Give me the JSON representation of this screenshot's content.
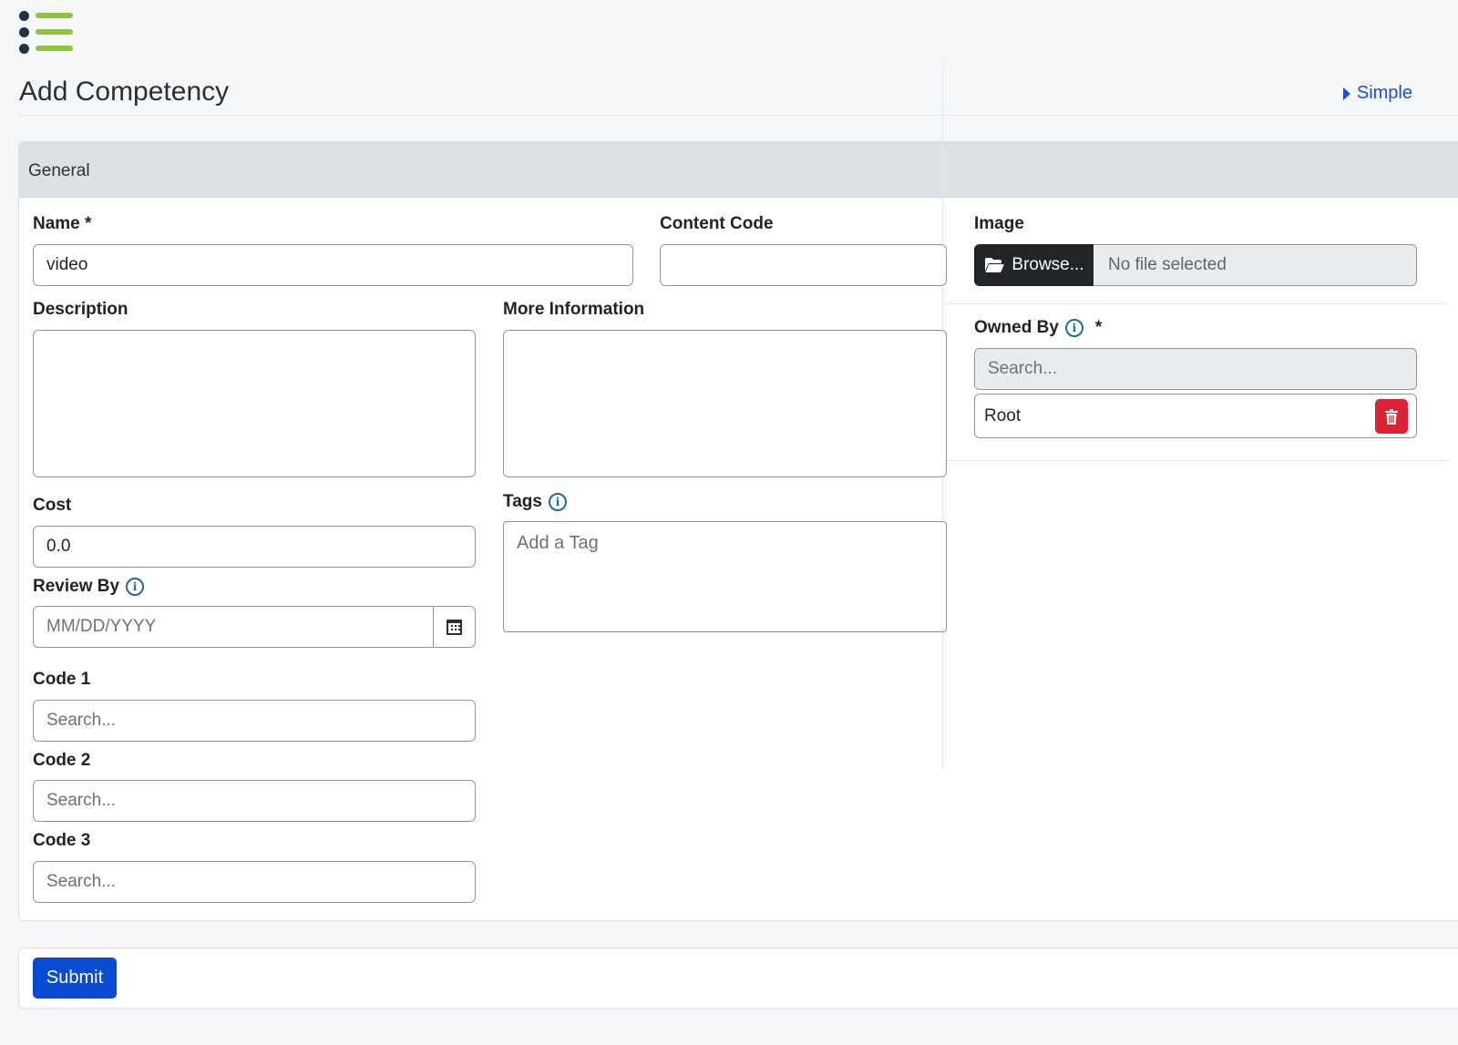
{
  "header": {
    "menu_icon": "list-menu-icon",
    "title": "Add Competency",
    "mode_link": "Simple",
    "mode_icon": "caret-right-icon"
  },
  "card": {
    "header_label": "General"
  },
  "form": {
    "name": {
      "label": "Name *",
      "value": "video"
    },
    "content_code": {
      "label": "Content Code",
      "value": ""
    },
    "description": {
      "label": "Description",
      "value": ""
    },
    "more_information": {
      "label": "More Information",
      "value": ""
    },
    "cost": {
      "label": "Cost",
      "value": "0.0"
    },
    "tags": {
      "label": "Tags",
      "placeholder": "Add a Tag"
    },
    "review_by": {
      "label": "Review By",
      "placeholder": "MM/DD/YYYY",
      "icon": "calendar-icon"
    },
    "code1": {
      "label": "Code 1",
      "placeholder": "Search..."
    },
    "code2": {
      "label": "Code 2",
      "placeholder": "Search..."
    },
    "code3": {
      "label": "Code 3",
      "placeholder": "Search..."
    }
  },
  "image": {
    "label": "Image",
    "browse_label": "Browse...",
    "browse_icon": "folder-open-icon",
    "file_status": "No file selected"
  },
  "owned_by": {
    "label": "Owned By",
    "required_mark": "*",
    "search_placeholder": "Search...",
    "items": [
      {
        "label": "Root",
        "remove_icon": "trash-icon"
      }
    ]
  },
  "footer": {
    "submit_label": "Submit"
  },
  "colors": {
    "primary": "#0a4bd4",
    "link": "#1f4fd0",
    "danger": "#dc2336",
    "dark_button": "#212529",
    "logo_green": "#8cc63f",
    "logo_navy": "#1d3344",
    "info_icon": "#1a6f8f"
  }
}
